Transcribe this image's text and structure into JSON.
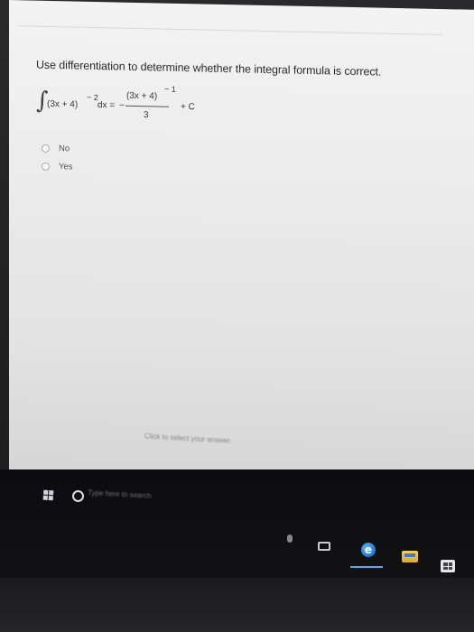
{
  "quiz": {
    "question": "Use differentiation to determine whether the integral formula is correct.",
    "formula": {
      "integral_sign": "∫",
      "integrand": "(3x + 4)",
      "integrand_exponent": "− 2",
      "dx": "dx =",
      "minus": "−",
      "numerator": "(3x + 4)",
      "numerator_exponent": "− 1",
      "denominator": "3",
      "constant": "+ C"
    },
    "options": [
      {
        "label": "No"
      },
      {
        "label": "Yes"
      }
    ],
    "hint": "Click to select your answer."
  },
  "taskbar": {
    "search_placeholder": "Type here to search",
    "icons": {
      "start": "windows-logo-icon",
      "cortana": "cortana-circle-icon",
      "mic": "microphone-icon",
      "task_view": "task-view-icon",
      "edge": "edge-browser-icon",
      "edge_glyph": "e",
      "explorer": "file-explorer-icon",
      "store": "store-icon"
    },
    "colors": {
      "accent": "#5fa8e8",
      "background": "#0c0c0e"
    }
  }
}
